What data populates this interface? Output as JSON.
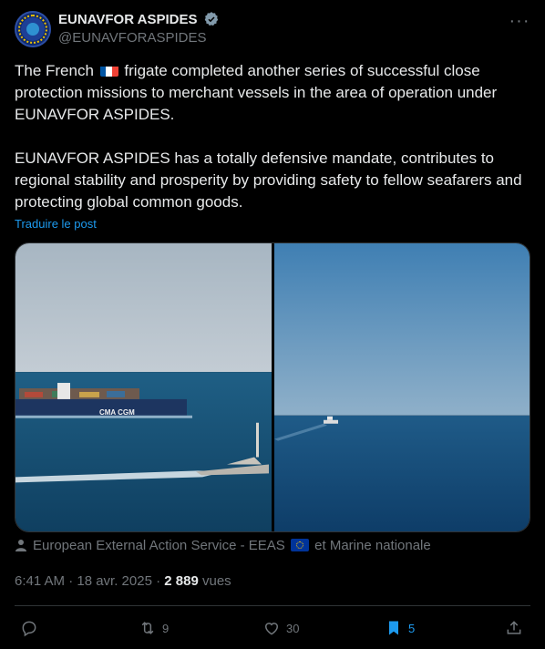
{
  "author": {
    "name": "EUNAVFOR ASPIDES",
    "handle": "@EUNAVFORASPIDES",
    "verified_icon": "verified-badge-icon"
  },
  "post": {
    "line1_before_flag": "The French",
    "line1_after_flag": "frigate completed another series of successful close protection missions to merchant vessels in the area of operation under EUNAVFOR ASPIDES.",
    "paragraph2": "EUNAVFOR ASPIDES has a totally defensive mandate, contributes to regional stability and prosperity by providing safety to fellow seafarers and protecting global common goods.",
    "translate_link": "Traduire le post",
    "ship_lettering": "CMA CGM"
  },
  "caption": {
    "before_flag": "European External Action Service - EEAS",
    "after_flag": "et Marine nationale"
  },
  "meta": {
    "time": "6:41 AM · 18 avr. 2025 · ",
    "views_count": "2 889",
    "views_label": " vues"
  },
  "actions": {
    "reply_count": "",
    "repost_count": "9",
    "like_count": "30",
    "bookmark_count": "5"
  },
  "colors": {
    "accent": "#1d9bf0",
    "muted": "#71767b",
    "text": "#e7e9ea",
    "background": "#000000"
  }
}
